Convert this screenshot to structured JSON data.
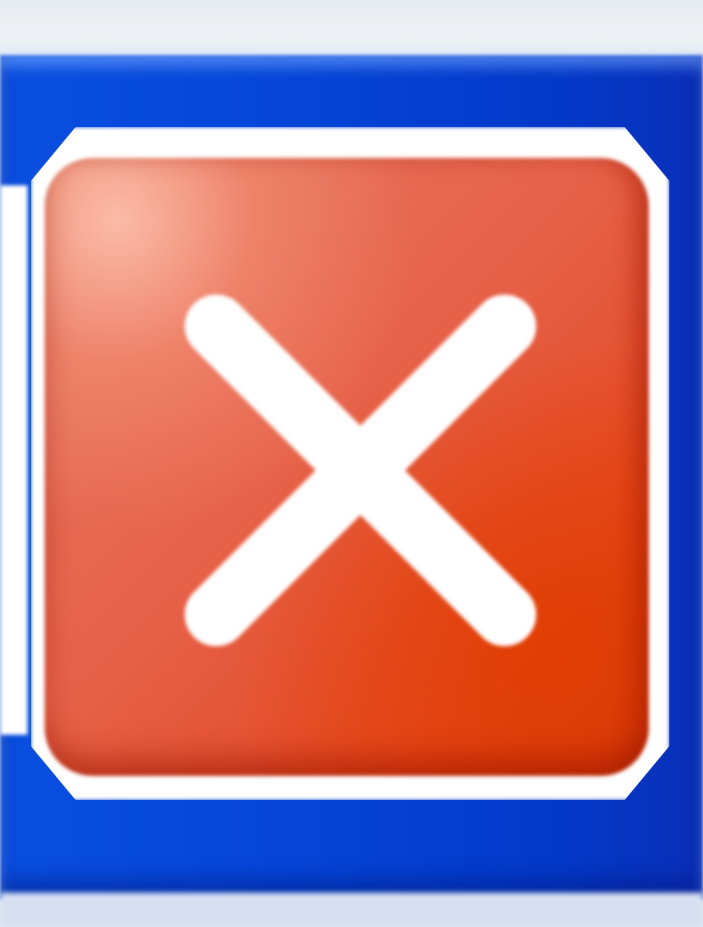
{
  "window": {
    "close_button": {
      "icon": "close-icon",
      "face_color": "#e4562f",
      "glyph_color": "#ffffff"
    },
    "title_bar_color": "#0546d8"
  }
}
